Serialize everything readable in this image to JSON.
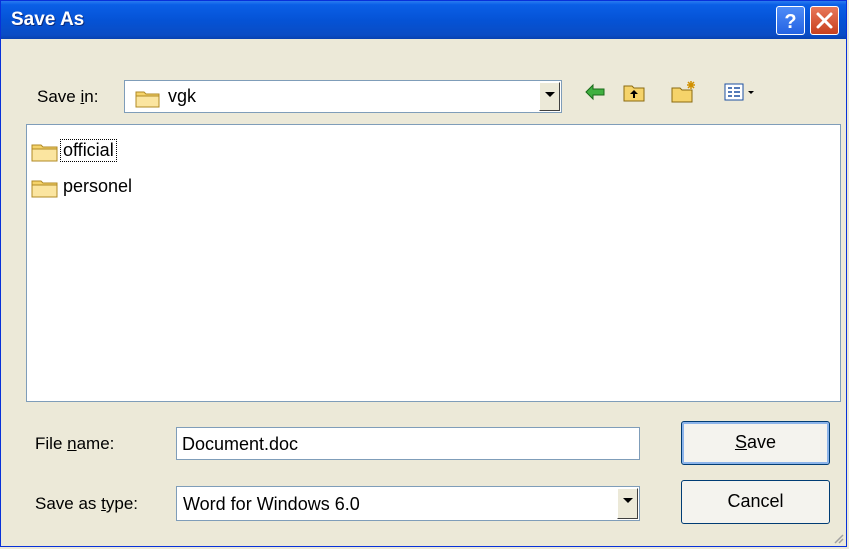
{
  "window": {
    "title": "Save As"
  },
  "title_buttons": {
    "help": "?",
    "close": "✕"
  },
  "save_in": {
    "label_pre": "Save ",
    "label_u": "i",
    "label_post": "n:",
    "value": "vgk"
  },
  "toolbar": {
    "icons": [
      "back-arrow-icon",
      "up-one-level-icon",
      "new-folder-icon",
      "view-menu-icon"
    ]
  },
  "files": [
    {
      "name": "official",
      "type": "folder",
      "focused": true
    },
    {
      "name": "personel",
      "type": "folder",
      "focused": false
    }
  ],
  "file_name": {
    "label_pre": "File ",
    "label_u": "n",
    "label_post": "ame:",
    "value": "Document.doc"
  },
  "save_as_type": {
    "label_pre": "Save as ",
    "label_u": "t",
    "label_post": "ype:",
    "value": "Word for Windows 6.0"
  },
  "buttons": {
    "save_u": "S",
    "save_rest": "ave",
    "cancel": "Cancel"
  },
  "colors": {
    "titlebar": "#0553D6",
    "dialog_bg": "#ECE9D8",
    "folder_yellow": "#F5D36A"
  }
}
